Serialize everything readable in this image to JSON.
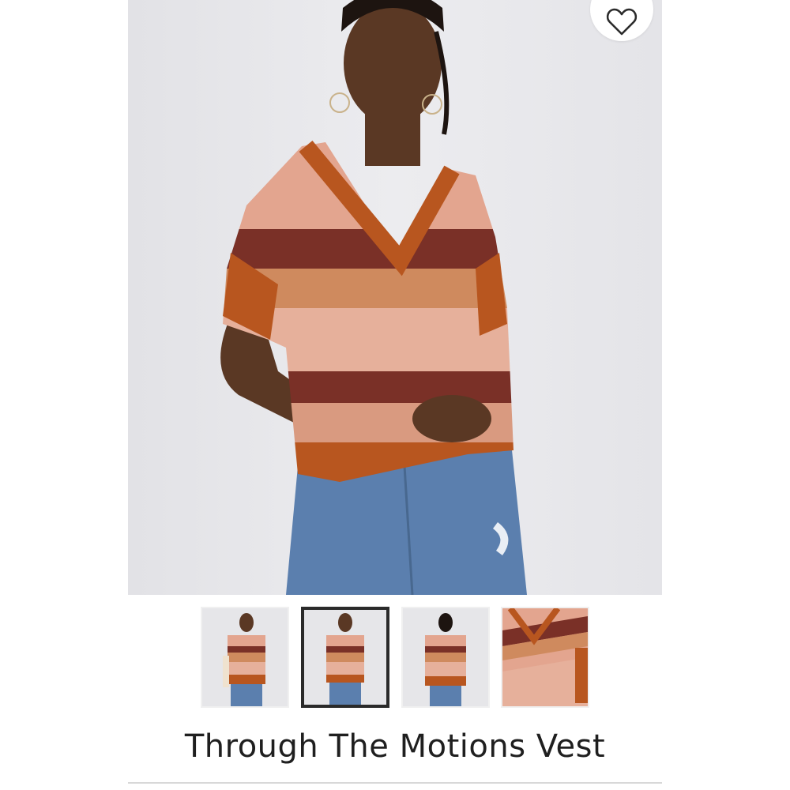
{
  "product": {
    "title": "Through The Motions Vest"
  },
  "favorite": {
    "icon": "heart-outline-icon",
    "selected": false
  },
  "gallery": {
    "selected_index": 1,
    "thumbnail_count": 4
  },
  "colors": {
    "rust": "#b8561f",
    "burgundy": "#7a3027",
    "blush": "#e3a58f",
    "tan": "#cf8a5e",
    "denim": "#5b7fae",
    "skin": "#5a3824"
  }
}
